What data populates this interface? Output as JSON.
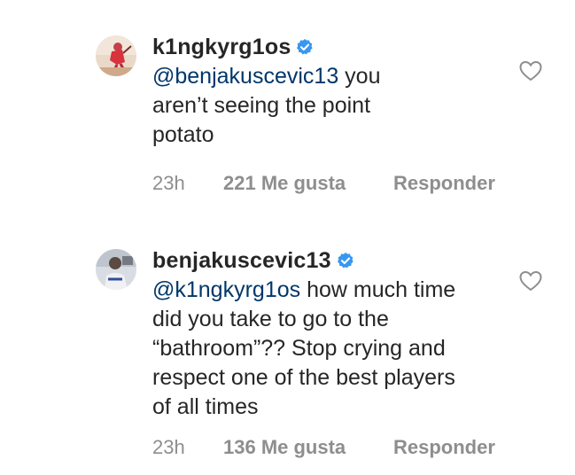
{
  "colors": {
    "text": "#262626",
    "mention": "#00376b",
    "meta": "#8e8e8e",
    "verified": "#3897f0"
  },
  "comments": [
    {
      "username": "k1ngkyrg1os",
      "verified": true,
      "mention": "@benjakuscevic13",
      "text": " you aren’t seeing the point potato",
      "time": "23h",
      "likes": "221 Me gusta",
      "reply": "Responder",
      "avatar_icon": "tennis-player-avatar"
    },
    {
      "username": "benjakuscevic13",
      "verified": true,
      "mention": "@k1ngkyrg1os",
      "text": " how much time did you take to go to the “bathroom”?? Stop crying and respect one of the best players of all times",
      "time": "23h",
      "likes": "136 Me gusta",
      "reply": "Responder",
      "avatar_icon": "player-photo-avatar"
    }
  ]
}
